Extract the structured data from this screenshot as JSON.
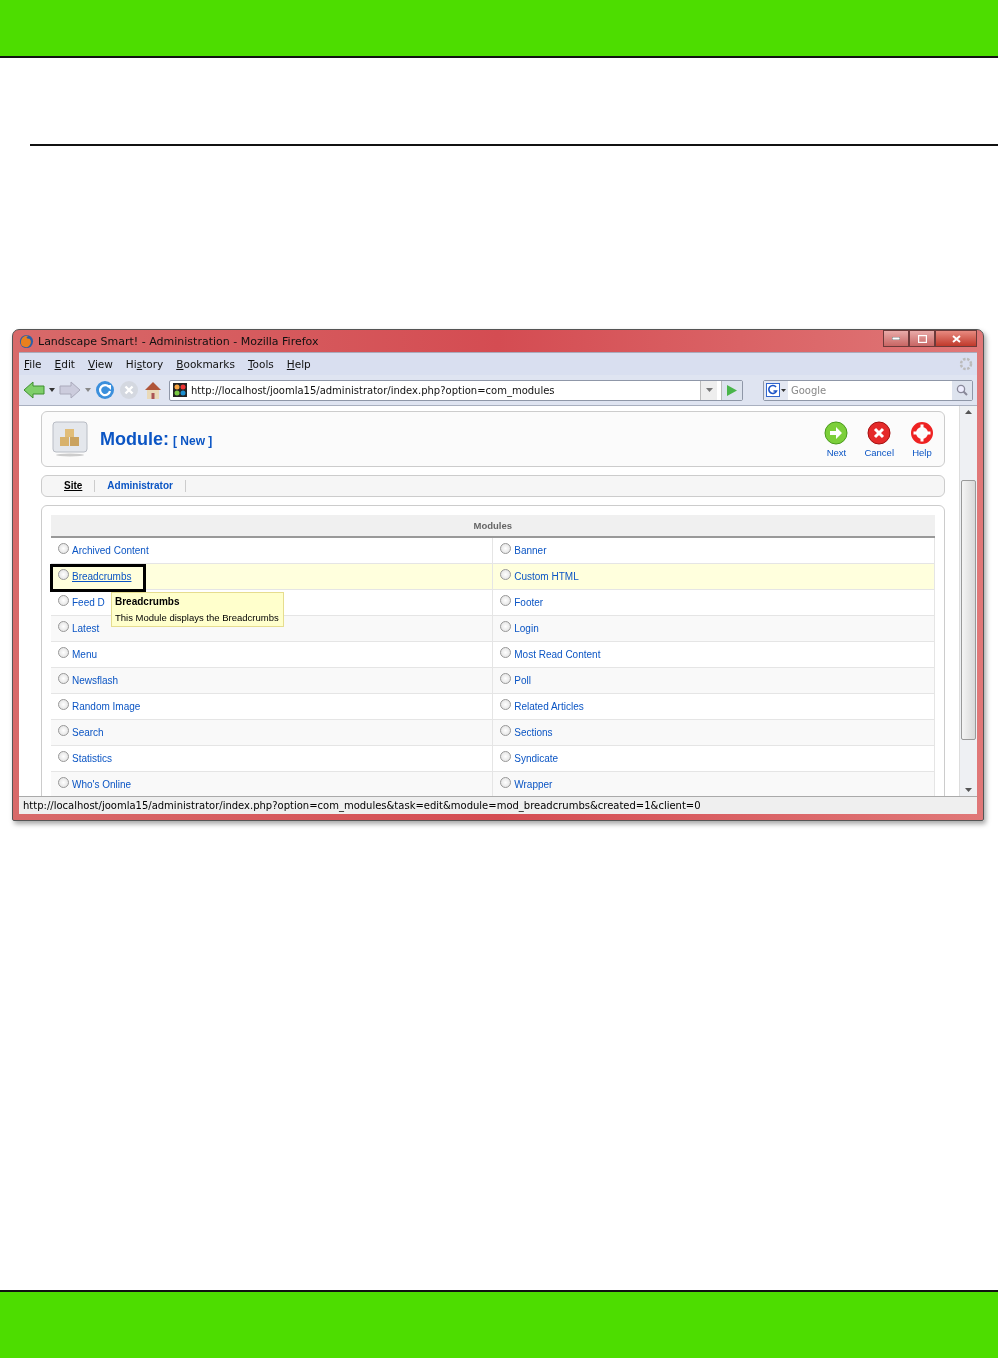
{
  "browser": {
    "title": "Landscape Smart! - Administration - Mozilla Firefox",
    "menu": [
      {
        "key": "F",
        "rest": "ile"
      },
      {
        "key": "E",
        "rest": "dit"
      },
      {
        "key": "V",
        "rest": "iew"
      },
      {
        "prefix": "Hi",
        "key": "s",
        "rest": "tory"
      },
      {
        "key": "B",
        "rest": "ookmarks"
      },
      {
        "key": "T",
        "rest": "ools"
      },
      {
        "key": "H",
        "rest": "elp"
      }
    ],
    "address": "http://localhost/joomla15/administrator/index.php?option=com_modules",
    "search": {
      "placeholder": "Google"
    },
    "status_bar": "http://localhost/joomla15/administrator/index.php?option=com_modules&task=edit&module=mod_breadcrumbs&created=1&client=0"
  },
  "page": {
    "title": "Module:",
    "subtitle": "[ New ]",
    "toolbar": [
      {
        "kind": "next",
        "label": "Next"
      },
      {
        "kind": "cancel",
        "label": "Cancel"
      },
      {
        "kind": "help",
        "label": "Help"
      }
    ],
    "tabs": [
      {
        "label": "Site",
        "selected": true
      },
      {
        "label": "Administrator",
        "selected": false
      }
    ],
    "modules": {
      "heading": "Modules",
      "rows": [
        {
          "highlighted": false,
          "cells": [
            {
              "label": "Archived Content",
              "selected": false,
              "hovered": false,
              "outlined": false
            },
            {
              "label": "Banner",
              "selected": false,
              "hovered": false,
              "outlined": false
            }
          ]
        },
        {
          "highlighted": true,
          "cells": [
            {
              "label": "Breadcrumbs",
              "selected": false,
              "hovered": true,
              "outlined": true
            },
            {
              "label": "Custom HTML",
              "selected": false,
              "hovered": false,
              "outlined": false
            }
          ]
        },
        {
          "highlighted": false,
          "cells": [
            {
              "label": "Feed D",
              "selected": false,
              "hovered": false,
              "outlined": false
            },
            {
              "label": "Footer",
              "selected": false,
              "hovered": false,
              "outlined": false
            }
          ]
        },
        {
          "highlighted": false,
          "cells": [
            {
              "label": "Latest",
              "selected": false,
              "hovered": false,
              "outlined": false
            },
            {
              "label": "Login",
              "selected": false,
              "hovered": false,
              "outlined": false
            }
          ]
        },
        {
          "highlighted": false,
          "cells": [
            {
              "label": "Menu",
              "selected": false,
              "hovered": false,
              "outlined": false
            },
            {
              "label": "Most Read Content",
              "selected": false,
              "hovered": false,
              "outlined": false
            }
          ]
        },
        {
          "highlighted": false,
          "cells": [
            {
              "label": "Newsflash",
              "selected": false,
              "hovered": false,
              "outlined": false
            },
            {
              "label": "Poll",
              "selected": false,
              "hovered": false,
              "outlined": false
            }
          ]
        },
        {
          "highlighted": false,
          "cells": [
            {
              "label": "Random Image",
              "selected": false,
              "hovered": false,
              "outlined": false
            },
            {
              "label": "Related Articles",
              "selected": false,
              "hovered": false,
              "outlined": false
            }
          ]
        },
        {
          "highlighted": false,
          "cells": [
            {
              "label": "Search",
              "selected": false,
              "hovered": false,
              "outlined": false
            },
            {
              "label": "Sections",
              "selected": false,
              "hovered": false,
              "outlined": false
            }
          ]
        },
        {
          "highlighted": false,
          "cells": [
            {
              "label": "Statistics",
              "selected": false,
              "hovered": false,
              "outlined": false
            },
            {
              "label": "Syndicate",
              "selected": false,
              "hovered": false,
              "outlined": false
            }
          ]
        },
        {
          "highlighted": false,
          "cells": [
            {
              "label": "Who's Online",
              "selected": false,
              "hovered": false,
              "outlined": false
            },
            {
              "label": "Wrapper",
              "selected": false,
              "hovered": false,
              "outlined": false
            }
          ]
        }
      ]
    },
    "tooltip": {
      "title": "Breadcrumbs",
      "text": "This Module displays the Breadcrumbs"
    }
  }
}
